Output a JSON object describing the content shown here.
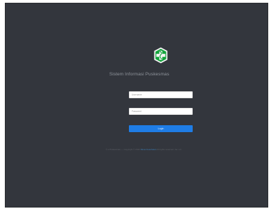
{
  "login": {
    "app_title": "Sistem Informasi Puskesmas",
    "username_placeholder": "Username",
    "password_placeholder": "Password",
    "login_label": "Login"
  },
  "footer": {
    "text_before": "© e-Puskesmas — Copyright © 2016",
    "link_text": "Dinas Kesehatan",
    "text_after": "All rights reserved. Ver 1.0"
  },
  "colors": {
    "background": "#33363d",
    "accent": "#1f7de6",
    "logo_green": "#12a43b"
  },
  "icons": {
    "logo": "puskesmas-cross-logo-icon"
  }
}
